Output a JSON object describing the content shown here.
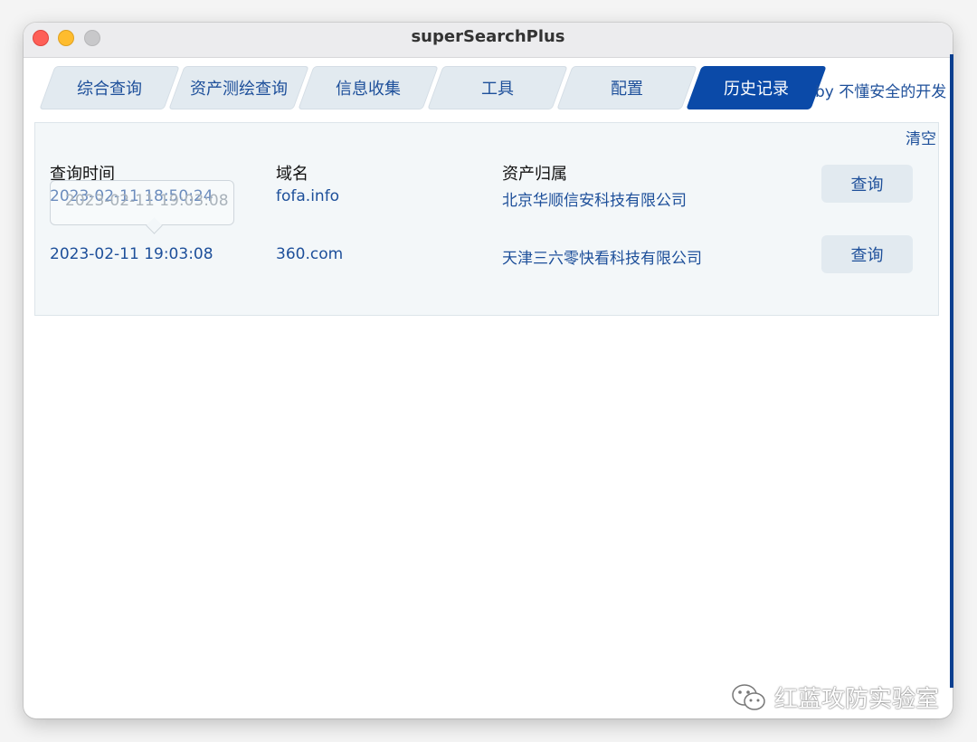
{
  "window": {
    "title": "superSearchPlus"
  },
  "tabs": [
    {
      "label": "综合查询",
      "active": false
    },
    {
      "label": "资产测绘查询",
      "active": false
    },
    {
      "label": "信息收集",
      "active": false
    },
    {
      "label": "工具",
      "active": false
    },
    {
      "label": "配置",
      "active": false
    },
    {
      "label": "历史记录",
      "active": true
    }
  ],
  "byline": "by 不懂安全的开发",
  "history": {
    "clear_label": "清空",
    "columns": [
      "查询时间",
      "域名",
      "资产归属"
    ],
    "rows": [
      {
        "time": "2023-02-11 18:50:24",
        "domain": "fofa.info",
        "owner": "北京华顺信安科技有限公司",
        "action": "查询"
      },
      {
        "time": "2023-02-11 19:03:08",
        "domain": "360.com",
        "owner": "天津三六零快看科技有限公司",
        "action": "查询"
      }
    ],
    "tooltip_text": "2023-02-11 19:03:08"
  },
  "watermark": {
    "text": "红蓝攻防实验室",
    "icon": "wechat-icon"
  },
  "colors": {
    "accent": "#0b4aa8",
    "text_link": "#1d4f9a",
    "tab_bg": "#e2eaf0",
    "panel_bg": "#f3f7f9"
  }
}
